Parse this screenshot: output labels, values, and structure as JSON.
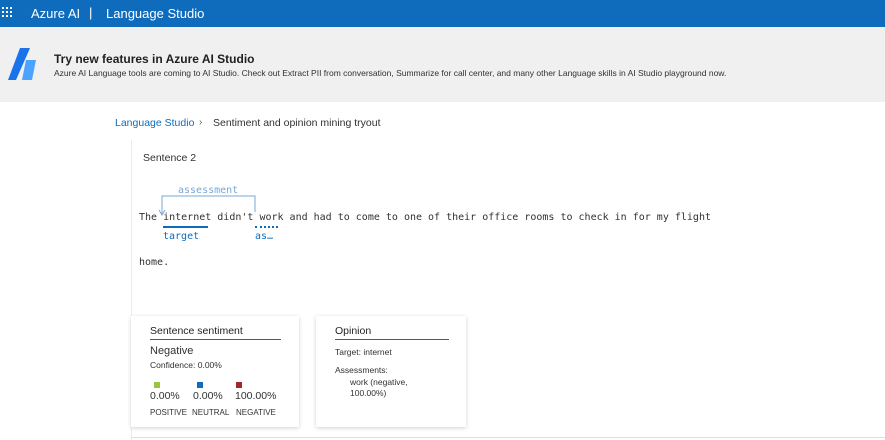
{
  "header": {
    "brand": "Azure AI",
    "separator": "|",
    "product": "Language Studio"
  },
  "banner": {
    "title": "Try new features in Azure AI Studio",
    "text": "Azure AI Language tools are coming to AI Studio. Check out Extract PII from conversation, Summarize for call center, and many other Language skills in AI Studio playground now."
  },
  "breadcrumb": {
    "home": "Language Studio",
    "chevron": "›",
    "current": "Sentiment and opinion mining tryout"
  },
  "sentence": {
    "title": "Sentence 2",
    "prefix": "The ",
    "target_word": "internet",
    "middle": " didn't ",
    "assessment_word": "work",
    "rest": " and had to come to one of their office rooms to check in for my flight",
    "line2": "home.",
    "relation_label": "assessment",
    "target_label": "target",
    "assessment_label_short": "as…"
  },
  "sentiment_card": {
    "title": "Sentence sentiment",
    "sentiment": "Negative",
    "confidence": "Confidence: 0.00%",
    "positive": {
      "score": "0.00%",
      "label": "POSITIVE",
      "color": "#9bc53d"
    },
    "neutral": {
      "score": "0.00%",
      "label": "NEUTRAL",
      "color": "#0f6cbd"
    },
    "negative": {
      "score": "100.00%",
      "label": "NEGATIVE",
      "color": "#a4262c"
    }
  },
  "opinion_card": {
    "title": "Opinion",
    "target": "Target: internet",
    "assessments_label": "Assessments:",
    "assessments_value": "work (negative, 100.00%)"
  },
  "colors": {
    "accent": "#0f6cbd",
    "banner_bg": "#f0f0f0"
  }
}
